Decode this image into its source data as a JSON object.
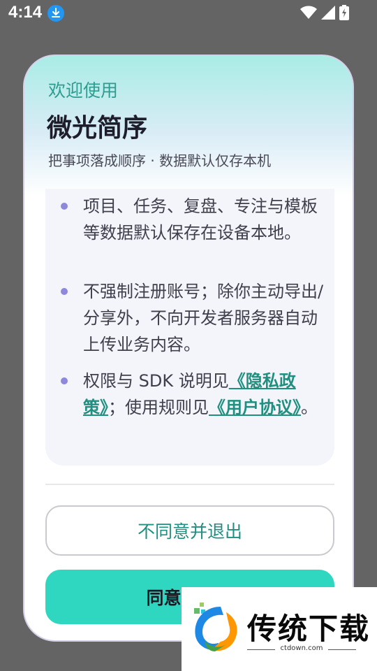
{
  "status_bar": {
    "time": "4:14",
    "icons": [
      "download-icon",
      "wifi-icon",
      "cell-signal-icon",
      "battery-charging-icon"
    ]
  },
  "dialog": {
    "welcome": "欢迎使用",
    "title": "微光简序",
    "subtitle": "把事项落成顺序 · 数据默认仅存本机",
    "bullets": [
      {
        "text": "项目、任务、复盘、专注与模板等数据默认保存在设备本地。"
      },
      {
        "text": "不强制注册账号；除你主动导出/分享外，不向开发者服务器自动上传业务内容。"
      },
      {
        "prefix": "权限与 SDK 说明见",
        "privacy_link": "《隐私政策》",
        "middle": "；使用规则见",
        "terms_link": "《用户协议》",
        "suffix": "。"
      }
    ],
    "decline_button": "不同意并退出",
    "agree_button": "同意并继续"
  },
  "watermark": {
    "brand": "传统下载",
    "domain": "ctdown.com"
  },
  "colors": {
    "accent": "#2fd6c0",
    "link": "#1f8f7f",
    "bullet_dot": "#8d88dc",
    "background": "#646464"
  }
}
